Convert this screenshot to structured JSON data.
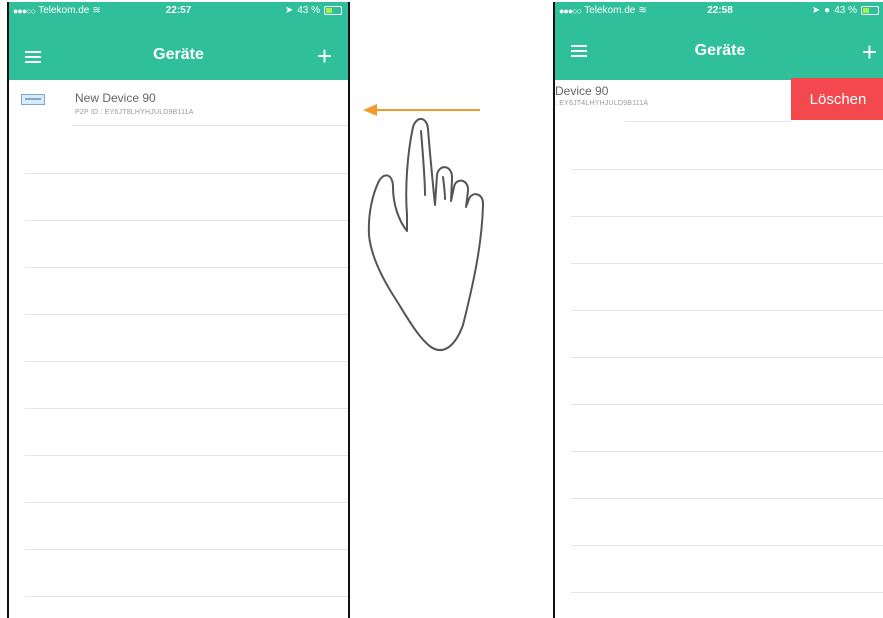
{
  "left_screen": {
    "status": {
      "carrier": "Telekom.de",
      "time": "22:57",
      "battery": "43 %"
    },
    "title": "Geräte",
    "device": {
      "name": "New Device 90",
      "id": "P2P ID : EY6JT8LHYHJULD9B111A"
    }
  },
  "right_screen": {
    "status": {
      "carrier": "Telekom.de",
      "time": "22:58",
      "battery": "43 %"
    },
    "title": "Geräte",
    "device": {
      "name": "Device 90",
      "id": ": EY6JT4LHYHJULD9B111A"
    },
    "delete_label": "Löschen"
  },
  "icons": {
    "menu": "hamburger-menu-icon",
    "add": "plus-icon",
    "device": "device-icon",
    "gesture": "swipe-left-hand-icon"
  },
  "colors": {
    "accent": "#2fbf9b",
    "delete": "#f2484e",
    "arrow": "#f29b2a",
    "separator": "#dde8ee"
  }
}
